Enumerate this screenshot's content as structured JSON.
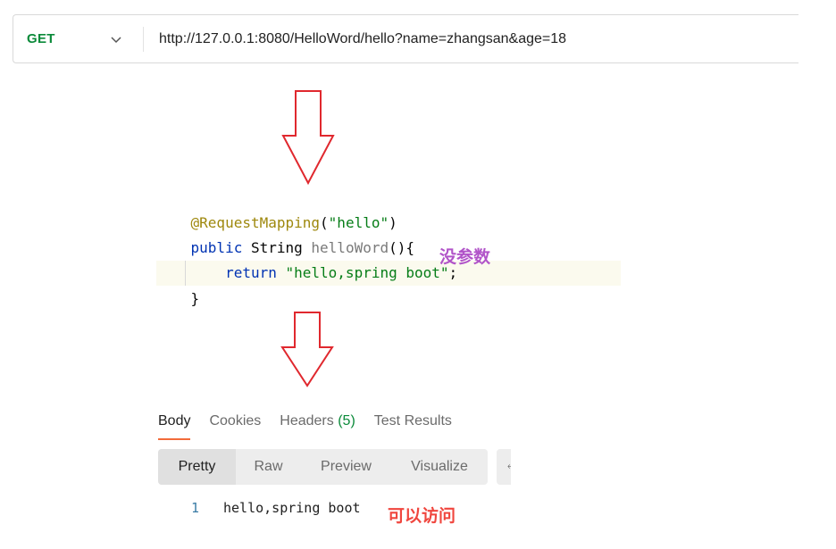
{
  "request": {
    "method": "GET",
    "url": "http://127.0.0.1:8080/HelloWord/hello?name=zhangsan&age=18"
  },
  "code": {
    "annotation": "@RequestMapping",
    "annotation_open": "(",
    "annotation_arg": "\"hello\"",
    "annotation_close": ")",
    "kw_public": "public",
    "type_string": "String",
    "method_name": "helloWord",
    "method_sig_tail": "(){",
    "kw_return": "return",
    "return_value": "\"hello,spring boot\"",
    "semicolon": ";",
    "closing_brace": "}"
  },
  "annotations": {
    "no_params": "没参数",
    "accessible": "可以访问"
  },
  "response": {
    "tabs": {
      "body": "Body",
      "cookies": "Cookies",
      "headers": "Headers",
      "headers_count": "(5)",
      "test_results": "Test Results"
    },
    "formats": {
      "pretty": "Pretty",
      "raw": "Raw",
      "preview": "Preview",
      "visualize": "Visualize"
    },
    "line_number": "1",
    "body_text": "hello,spring boot"
  },
  "colors": {
    "method_green": "#0b8a3a",
    "arrow_red": "#e0282e",
    "note_purple": "#b154c9",
    "note_red": "#f0463e",
    "tab_underline": "#f26b3a"
  },
  "icons": {
    "method_dropdown": "chevron-down-icon",
    "arrows": "arrow-down-icon"
  }
}
